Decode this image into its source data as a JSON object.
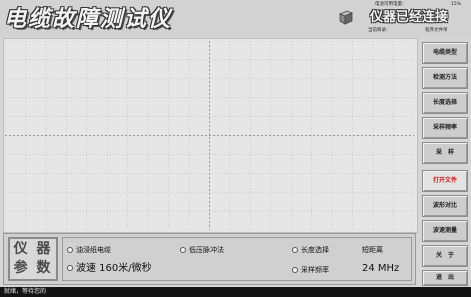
{
  "header": {
    "app_title": "电缆故障测试仪",
    "connection_status": "仪器已经连接",
    "device_icon": "device-box-icon",
    "battery_label": "电池可用电量：",
    "battery_value": "15%",
    "dir_label": "当前目录：",
    "dir_value": "程序文件单"
  },
  "side_buttons": [
    {
      "label": "电缆类型",
      "active": false
    },
    {
      "label": "检测方法",
      "active": false
    },
    {
      "label": "长度选择",
      "active": false
    },
    {
      "label": "采样频率",
      "active": false
    },
    {
      "label": "采　样",
      "active": false
    },
    {
      "label": "打开文件",
      "active": true
    },
    {
      "label": "波形对比",
      "active": false
    },
    {
      "label": "波速测量",
      "active": false
    },
    {
      "label": "关　于",
      "active": false
    },
    {
      "label": "退　出",
      "active": false
    }
  ],
  "params": {
    "title_line1": "仪 器",
    "title_line2": "参 数",
    "cable_type": "油浸纸电缆",
    "method": "低压脉冲法",
    "length_label": "长度选择",
    "length_value": "短距离",
    "velocity": "波速 160米/微秒",
    "sample_label": "采样频率",
    "sample_value": "24 MHz"
  },
  "status": {
    "text": "就绪，等待您的"
  },
  "colors": {
    "active_button_text": "#d01818",
    "status_bar_bg": "#141414"
  }
}
